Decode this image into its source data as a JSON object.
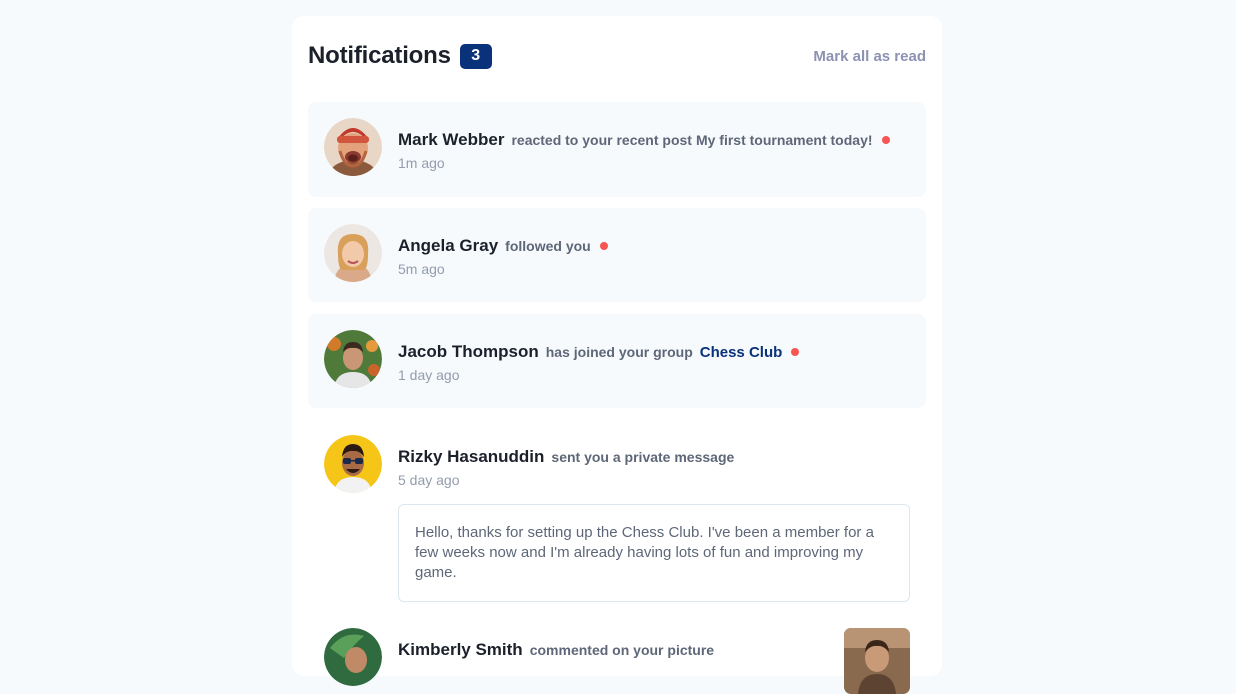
{
  "header": {
    "title": "Notifications",
    "unread_count": "3",
    "mark_all_label": "Mark all as read"
  },
  "notifications": [
    {
      "name": "Mark Webber",
      "action": "reacted to your recent post",
      "target": "My first tournament today!",
      "time": "1m ago",
      "unread": true
    },
    {
      "name": "Angela Gray",
      "action": "followed you",
      "time": "5m ago",
      "unread": true
    },
    {
      "name": "Jacob Thompson",
      "action": "has joined your group",
      "target": "Chess Club",
      "time": "1 day ago",
      "unread": true
    },
    {
      "name": "Rizky Hasanuddin",
      "action": "sent you a private message",
      "time": "5 day ago",
      "message": "Hello, thanks for setting up the Chess Club. I've been a member for a few weeks now and I'm already having lots of fun and improving my game.",
      "unread": false
    },
    {
      "name": "Kimberly Smith",
      "action": "commented on your picture",
      "unread": false
    }
  ],
  "colors": {
    "background": "#f7fafd",
    "badge": "#0a327b",
    "unread_dot": "#f65552",
    "group_link": "#0a327b"
  }
}
